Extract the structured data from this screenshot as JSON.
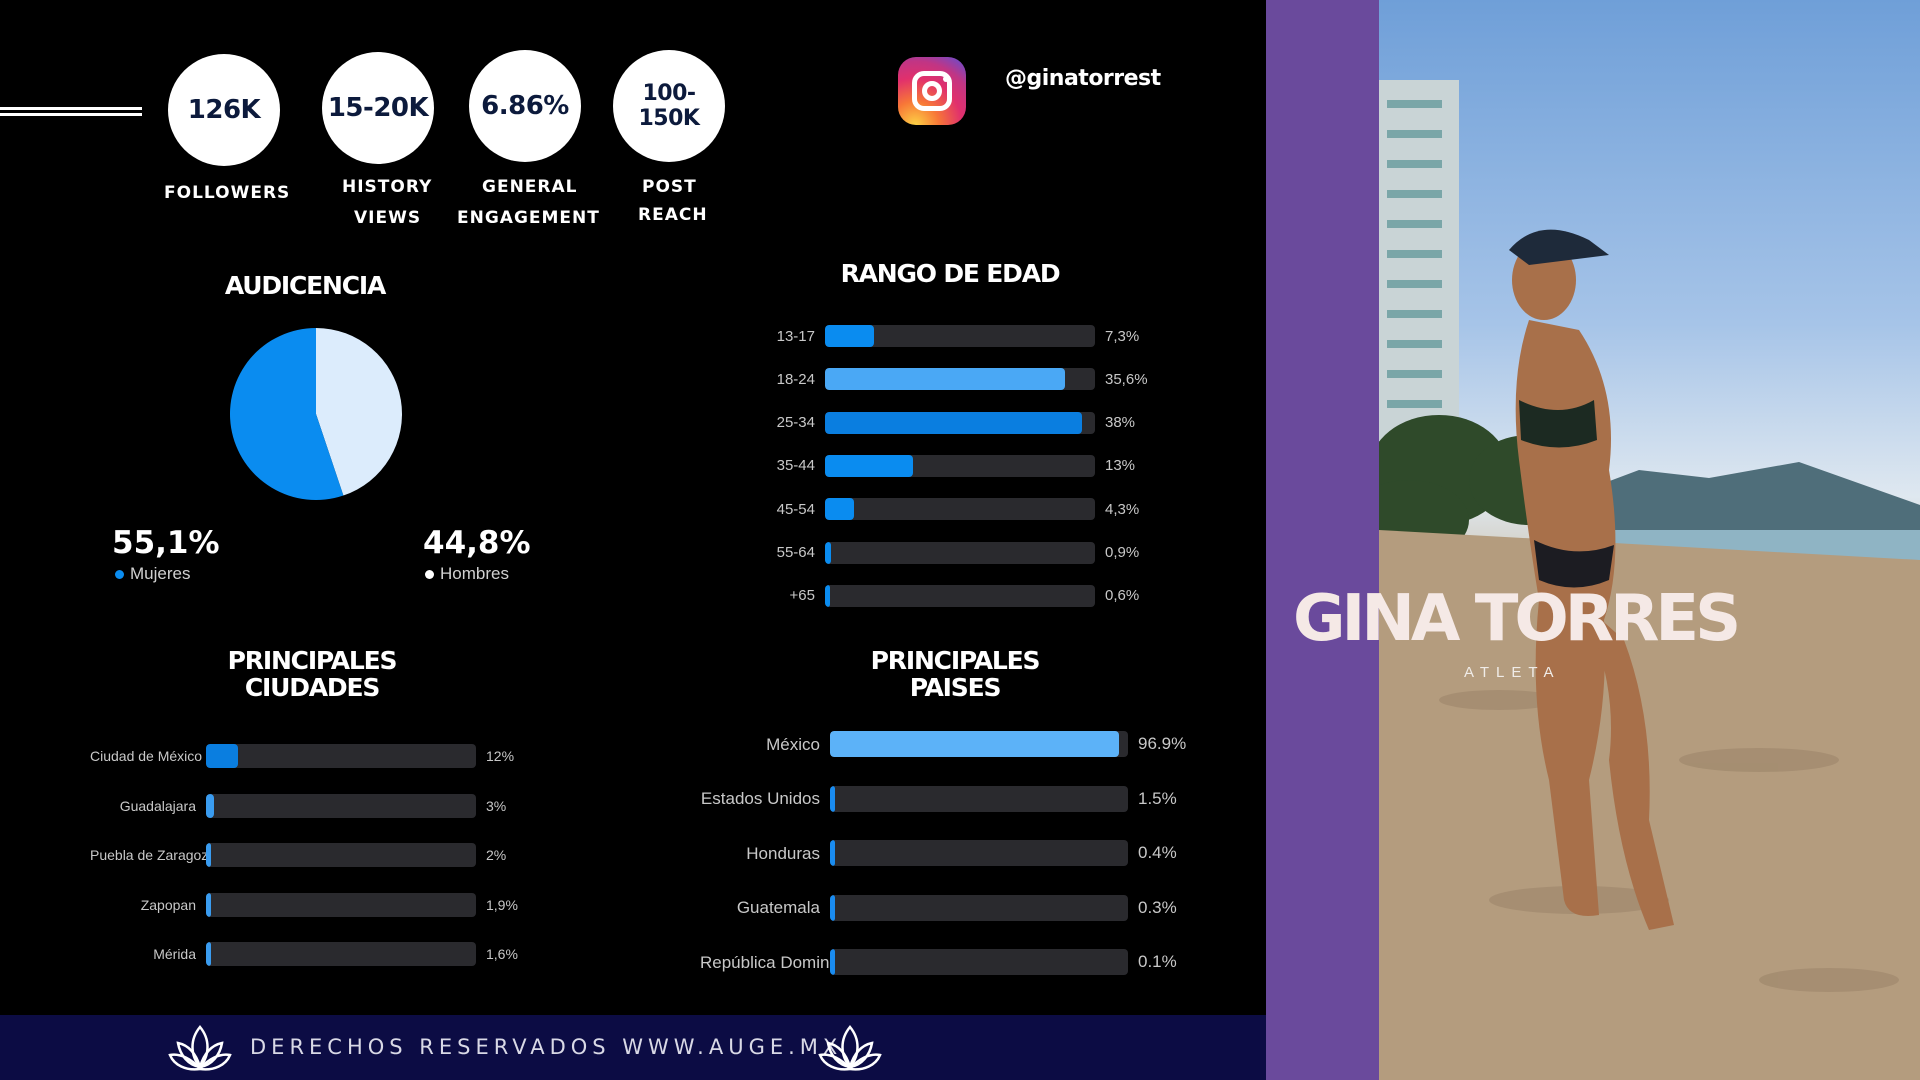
{
  "stats": [
    {
      "value": "126K",
      "label1": "FOLLOWERS",
      "label2": ""
    },
    {
      "value": "15-20K",
      "label1": "HISTORY",
      "label2": "VIEWS"
    },
    {
      "value": "6.86%",
      "label1": "GENERAL",
      "label2": "ENGAGEMENT"
    },
    {
      "value": "100-150K",
      "label1": "POST",
      "label2": "REACH"
    }
  ],
  "instagram": {
    "handle": "@ginatorrest"
  },
  "profile": {
    "name": "GINA TORRES",
    "role": "ATLETA"
  },
  "footer": {
    "text": "DERECHOS RESERVADOS WWW.AUGE.MX"
  },
  "colors": {
    "dark_blue": "#0a8cf0",
    "light_blue": "#dcecfc",
    "bar_mid": "#4aa8f5",
    "purple": "#6a4a9c",
    "footer": "#0c0c44"
  },
  "chart_data": [
    {
      "type": "pie",
      "title": "AUDICENCIA",
      "slices": [
        {
          "label": "Mujeres",
          "value": 55.1,
          "display": "55,1%",
          "color": "#0a8cf0"
        },
        {
          "label": "Hombres",
          "value": 44.8,
          "display": "44,8%",
          "color": "#dcecfc"
        }
      ]
    },
    {
      "type": "bar",
      "title": "RANGO DE EDAD",
      "orientation": "horizontal",
      "categories": [
        "13-17",
        "18-24",
        "25-34",
        "35-44",
        "45-54",
        "55-64",
        "+65"
      ],
      "values": [
        7.3,
        35.6,
        38,
        13,
        4.3,
        0.9,
        0.6
      ],
      "value_labels": [
        "7,3%",
        "35,6%",
        "38%",
        "13%",
        "4,3%",
        "0,9%",
        "0,6%"
      ],
      "xlim": [
        0,
        100
      ]
    },
    {
      "type": "bar",
      "title": "PRINCIPALES CIUDADES",
      "orientation": "horizontal",
      "categories": [
        "Ciudad de México",
        "Guadalajara",
        "Puebla de Zaragoza",
        "Zapopan",
        "Mérida"
      ],
      "values": [
        12,
        3,
        2,
        1.9,
        1.6
      ],
      "value_labels": [
        "12%",
        "3%",
        "2%",
        "1,9%",
        "1,6%"
      ],
      "xlim": [
        0,
        100
      ]
    },
    {
      "type": "bar",
      "title": "PRINCIPALES PAISES",
      "orientation": "horizontal",
      "categories": [
        "México",
        "Estados Unidos",
        "Honduras",
        "Guatemala",
        "República Dominicana"
      ],
      "values": [
        96.9,
        1.5,
        0.4,
        0.3,
        0.1
      ],
      "value_labels": [
        "96.9%",
        "1.5%",
        "0.4%",
        "0.3%",
        "0.1%"
      ],
      "xlim": [
        0,
        100
      ]
    }
  ]
}
